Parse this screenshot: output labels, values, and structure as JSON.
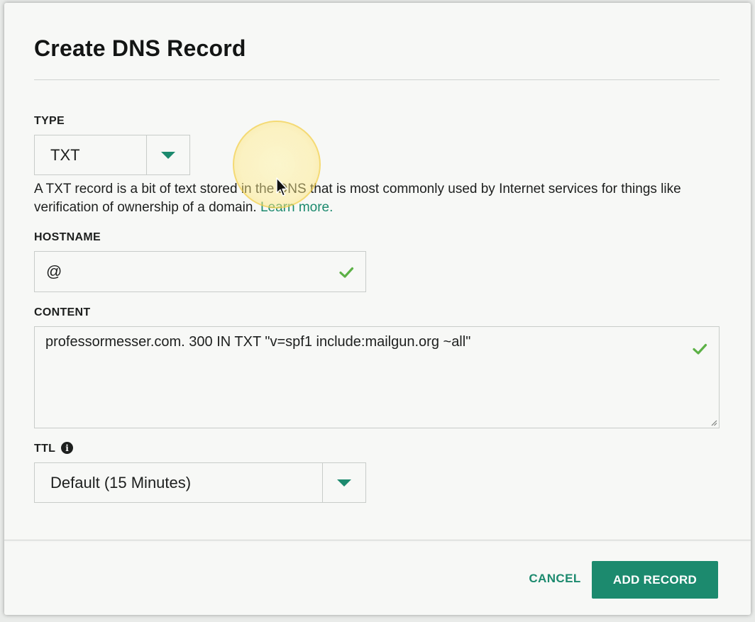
{
  "dialog": {
    "title": "Create DNS Record"
  },
  "type_field": {
    "label": "TYPE",
    "value": "TXT",
    "help_text": "A TXT record is a bit of text stored in the DNS that is most commonly used by Internet services for things like verification of ownership of a domain.",
    "help_link": "Learn more."
  },
  "hostname_field": {
    "label": "HOSTNAME",
    "value": "@",
    "status_icon": "check-icon"
  },
  "content_field": {
    "label": "CONTENT",
    "value": "professormesser.com. 300 IN TXT \"v=spf1 include:mailgun.org ~all\"",
    "status_icon": "check-icon"
  },
  "ttl_field": {
    "label": "TTL",
    "info_icon": "info-icon",
    "info_glyph": "i",
    "value": "Default (15 Minutes)"
  },
  "footer": {
    "cancel_label": "CANCEL",
    "submit_label": "ADD RECORD"
  },
  "colors": {
    "accent": "#1c8a6e",
    "valid_check": "#5cb146",
    "text": "#1d1f1e",
    "background": "#f7f8f6"
  }
}
